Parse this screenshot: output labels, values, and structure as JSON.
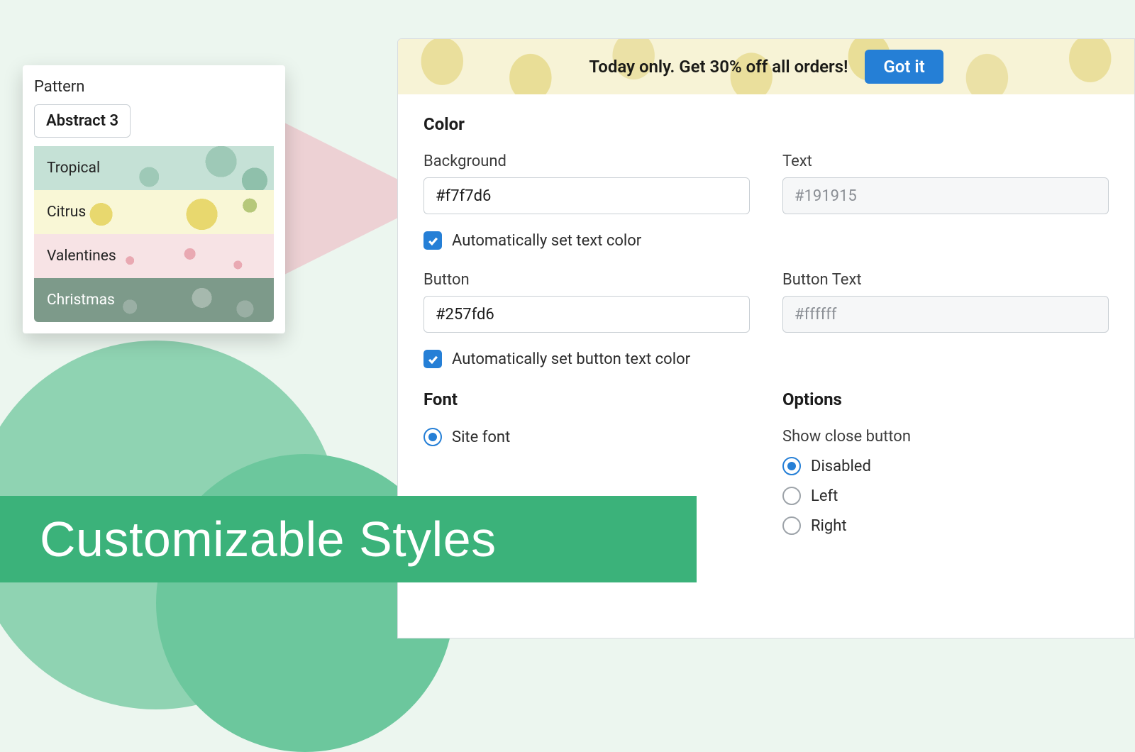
{
  "pattern": {
    "label": "Pattern",
    "selected": "Abstract 3",
    "options": [
      "Tropical",
      "Citrus",
      "Valentines",
      "Christmas"
    ]
  },
  "banner": {
    "message": "Today only. Get 30% off all orders!",
    "button": "Got it"
  },
  "sections": {
    "color": {
      "title": "Color",
      "background_label": "Background",
      "background_value": "#f7f7d6",
      "text_label": "Text",
      "text_value": "#191915",
      "auto_text": "Automatically set text color",
      "button_label": "Button",
      "button_value": "#257fd6",
      "button_text_label": "Button Text",
      "button_text_value": "#ffffff",
      "auto_button": "Automatically set button text color"
    },
    "font": {
      "title": "Font",
      "site_font": "Site font"
    },
    "options": {
      "title": "Options",
      "close_label": "Show close button",
      "choices": [
        "Disabled",
        "Left",
        "Right"
      ],
      "selected": "Disabled"
    }
  },
  "caption": "Customizable Styles"
}
